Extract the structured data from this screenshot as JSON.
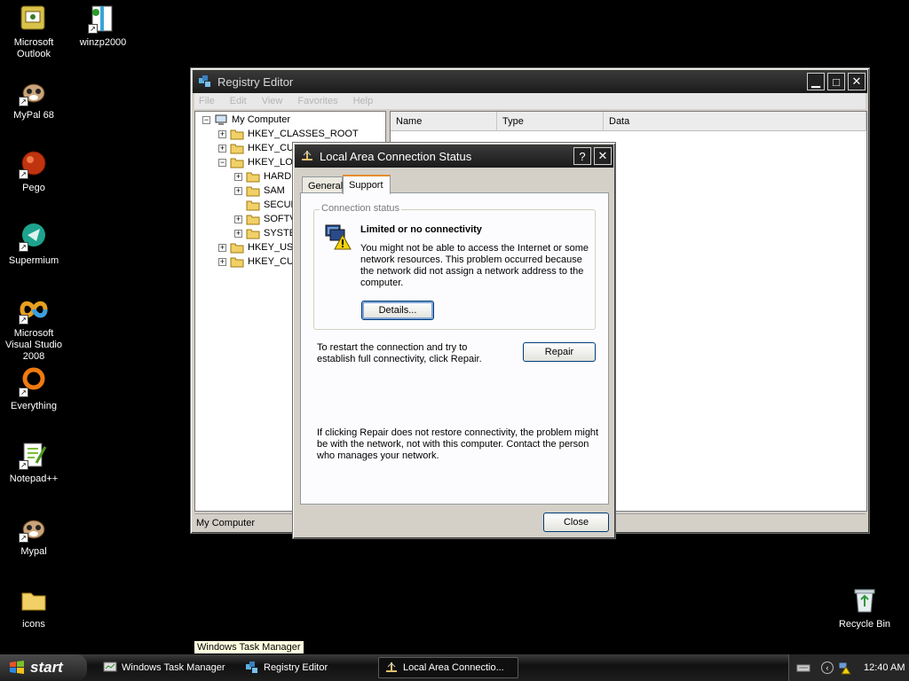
{
  "desktop": {
    "icons": [
      {
        "label": "Microsoft Outlook",
        "icon": "outlook-icon"
      },
      {
        "label": "winzp2000",
        "icon": "winzip-icon"
      },
      {
        "label": "MyPal 68",
        "icon": "mypal-icon"
      },
      {
        "label": "Pego",
        "icon": "pego-icon"
      },
      {
        "label": "Supermium",
        "icon": "supermium-icon"
      },
      {
        "label": "Microsoft Visual Studio 2008",
        "icon": "visual-studio-icon"
      },
      {
        "label": "Everything",
        "icon": "everything-icon"
      },
      {
        "label": "Notepad++",
        "icon": "notepadpp-icon"
      },
      {
        "label": "Mypal",
        "icon": "mypal-icon"
      },
      {
        "label": "icons",
        "icon": "folder-icon"
      },
      {
        "label": "Recycle Bin",
        "icon": "recycle-bin-icon"
      }
    ]
  },
  "regedit": {
    "title": "Registry Editor",
    "menu": [
      "File",
      "Edit",
      "View",
      "Favorites",
      "Help"
    ],
    "tree": [
      {
        "label": "My Computer",
        "expander": "−"
      },
      {
        "label": "HKEY_CLASSES_ROOT",
        "expander": "+"
      },
      {
        "label": "HKEY_CUR",
        "expander": "+"
      },
      {
        "label": "HKEY_LOC",
        "expander": "−"
      },
      {
        "label": "HARD",
        "expander": "+"
      },
      {
        "label": "SAM",
        "expander": "+"
      },
      {
        "label": "SECUR",
        "expander": ""
      },
      {
        "label": "SOFTV",
        "expander": "+"
      },
      {
        "label": "SYSTE",
        "expander": "+"
      },
      {
        "label": "HKEY_USE",
        "expander": "+"
      },
      {
        "label": "HKEY_CUR",
        "expander": "+"
      }
    ],
    "columns": [
      "Name",
      "Type",
      "Data"
    ],
    "status": "My Computer"
  },
  "lac": {
    "title": "Local Area Connection Status",
    "help_btn": "?",
    "close_btn": "✕",
    "tabs": [
      "General",
      "Support"
    ],
    "active_tab": "Support",
    "group_label": "Connection status",
    "status_title": "Limited or no connectivity",
    "status_text": "You might not be able to access the Internet or some network resources. This problem occurred because the network did not assign a network address to the computer.",
    "details_label": "Details...",
    "repair_text": "To restart the connection and try to establish full connectivity, click Repair.",
    "repair_label": "Repair",
    "footer_text": "If clicking Repair does not restore connectivity, the problem might be with the network, not with this computer. Contact the person who manages your network.",
    "close_label": "Close"
  },
  "tooltip": "Windows Task Manager",
  "taskbar": {
    "start_label": "start",
    "tasks": [
      {
        "label": "Windows Task Manager",
        "icon": "task-manager-icon"
      },
      {
        "label": "Registry Editor",
        "icon": "regedit-icon"
      },
      {
        "label": "Local Area Connectio...",
        "icon": "network-icon"
      }
    ],
    "clock": "12:40 AM"
  }
}
